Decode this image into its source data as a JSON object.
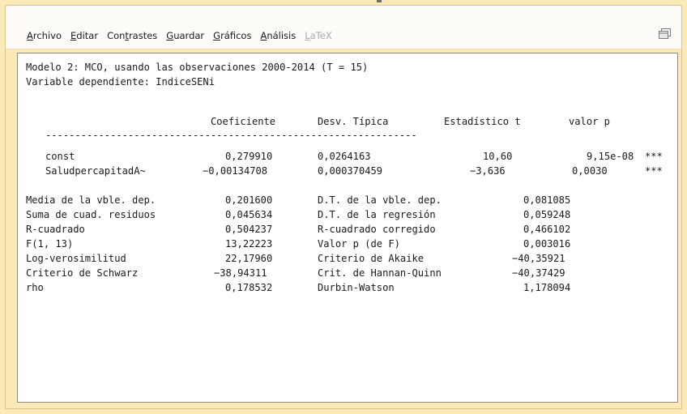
{
  "menu": {
    "items": [
      {
        "label": "Archivo",
        "mnemonic": "A",
        "rest": "rchivo",
        "enabled": true
      },
      {
        "label": "Editar",
        "mnemonic": "E",
        "rest": "ditar",
        "enabled": true
      },
      {
        "label": "Contrastes",
        "pre": "Con",
        "mnemonic": "t",
        "rest": "rastes",
        "enabled": true
      },
      {
        "label": "Guardar",
        "mnemonic": "G",
        "rest": "uardar",
        "enabled": true
      },
      {
        "label": "Gráficos",
        "mnemonic": "G",
        "rest": "ráficos",
        "enabled": true
      },
      {
        "label": "Análisis",
        "mnemonic": "A",
        "rest": "nálisis",
        "enabled": true
      },
      {
        "label": "LaTeX",
        "mnemonic": "L",
        "rest": "aTeX",
        "enabled": false
      }
    ]
  },
  "output": {
    "header_line1": "Modelo 2: MCO, usando las observaciones 2000-2014 (T = 15)",
    "header_line2": "Variable dependiente: IndiceSENi",
    "columns": {
      "coef": "Coeficiente",
      "se": "Desv. Típica",
      "t": "Estadístico t",
      "p": "valor p"
    },
    "separator": "---------------------------------------------------------------",
    "coef_rows": [
      {
        "name": "const",
        "coef": "0,279910",
        "se": "0,0264163",
        "t": "10,60",
        "p": "9,15e-08",
        "stars": "***"
      },
      {
        "name": "SaludpercapitadA~",
        "coef": "−0,00134708",
        "se": "0,000370459",
        "t": "−3,636",
        "p": "0,0030",
        "stars": "***"
      }
    ],
    "stats": [
      {
        "l_label": "Media de la vble. dep.",
        "l_value": "0,201600",
        "r_label": "D.T. de la vble. dep.",
        "r_value": "0,081085"
      },
      {
        "l_label": "Suma de cuad. residuos",
        "l_value": "0,045634",
        "r_label": "D.T. de la regresión",
        "r_value": "0,059248"
      },
      {
        "l_label": "R-cuadrado",
        "l_value": "0,504237",
        "r_label": "R-cuadrado corregido",
        "r_value": "0,466102"
      },
      {
        "l_label": "F(1, 13)",
        "l_value": "13,22223",
        "r_label": "Valor p (de F)",
        "r_value": "0,003016"
      },
      {
        "l_label": "Log-verosimilitud",
        "l_value": "22,17960",
        "r_label": "Criterio de Akaike",
        "r_value": "−40,35921"
      },
      {
        "l_label": "Criterio de Schwarz",
        "l_value": "−38,94311",
        "r_label": "Crit. de Hannan-Quinn",
        "r_value": "−40,37429"
      },
      {
        "l_label": "rho",
        "l_value": "0,178532",
        "r_label": "Durbin-Watson",
        "r_value": "1,178094"
      }
    ]
  }
}
